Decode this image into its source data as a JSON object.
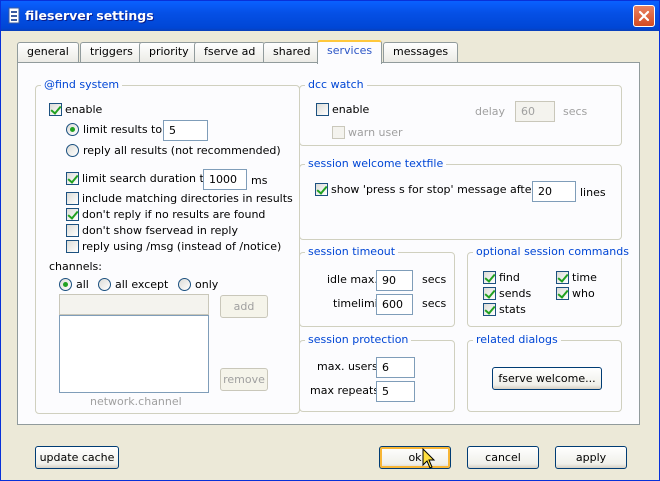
{
  "window": {
    "title": "fileserver settings"
  },
  "tabs": [
    {
      "label": "general"
    },
    {
      "label": "triggers"
    },
    {
      "label": "priority"
    },
    {
      "label": "fserve ad"
    },
    {
      "label": "shared"
    },
    {
      "label": "services",
      "active": true
    },
    {
      "label": "messages"
    }
  ],
  "find": {
    "title": "@find system",
    "enable": "enable",
    "limit_results": "limit results to",
    "limit_results_value": "5",
    "reply_all": "reply all results (not recommended)",
    "limit_duration": "limit search duration to",
    "limit_duration_value": "1000",
    "ms": "ms",
    "include_dirs": "include matching directories in results",
    "dont_reply": "don't reply if no results are found",
    "dont_show": "don't show fservead in reply",
    "reply_msg": "reply using /msg (instead of /notice)",
    "channels": "channels:",
    "all": "all",
    "all_except": "all except",
    "only": "only",
    "add": "add",
    "remove": "remove",
    "network_channel": "network.channel"
  },
  "dcc": {
    "title": "dcc watch",
    "enable": "enable",
    "delay": "delay",
    "delay_value": "60",
    "secs": "secs",
    "warn_user": "warn user"
  },
  "welcome": {
    "title": "session welcome textfile",
    "show": "show 'press s for stop' message after",
    "lines_value": "20",
    "lines": "lines"
  },
  "timeout": {
    "title": "session timeout",
    "idle_max": "idle max.",
    "idle_value": "90",
    "timelimit": "timelimit",
    "timelimit_value": "600",
    "secs": "secs"
  },
  "optional": {
    "title": "optional session commands",
    "find": "find",
    "time": "time",
    "sends": "sends",
    "who": "who",
    "stats": "stats"
  },
  "protection": {
    "title": "session protection",
    "max_users": "max. users",
    "max_users_value": "6",
    "max_repeats": "max repeats",
    "max_repeats_value": "5"
  },
  "related": {
    "title": "related dialogs",
    "fserve_welcome": "fserve welcome..."
  },
  "bottom": {
    "update_cache": "update cache",
    "ok": "ok",
    "cancel": "cancel",
    "apply": "apply"
  }
}
